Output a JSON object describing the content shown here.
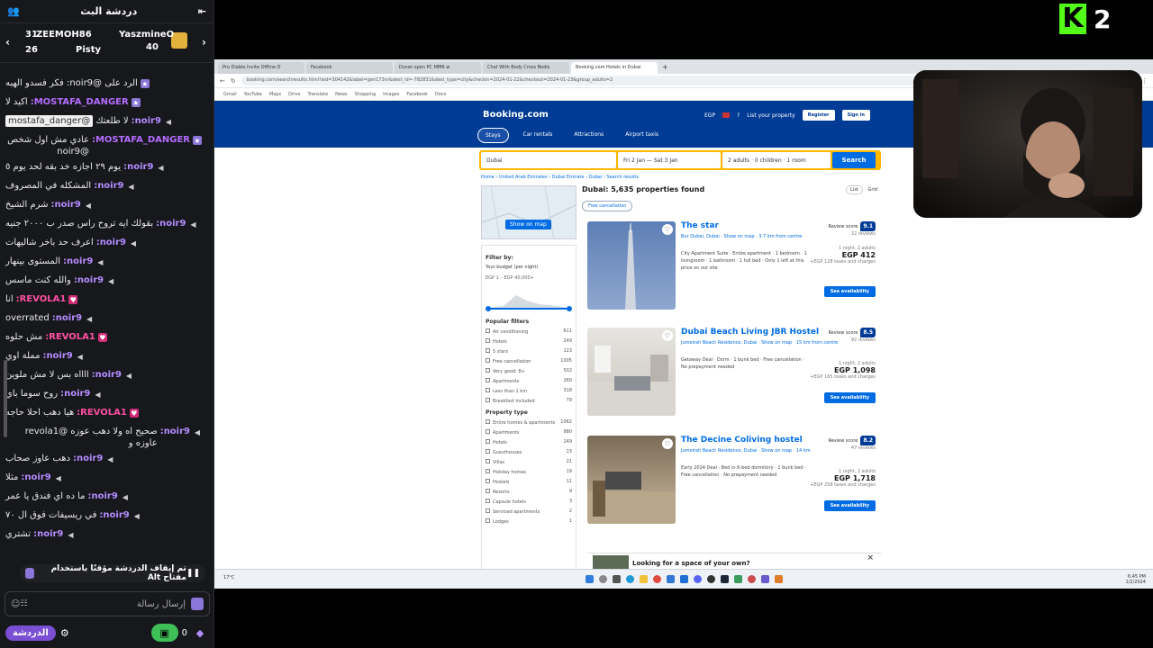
{
  "chat": {
    "title": "دردشة البث",
    "leaders": [
      {
        "name": "YaszmineO",
        "count": "40"
      },
      {
        "name": "ZEEMOH86",
        "count": "31"
      },
      {
        "name": "Pisty",
        "count": "26"
      }
    ],
    "messages": [
      {
        "user": "",
        "text": "الرد على @noir9: فكر فسدو الهبه",
        "icon": "mod",
        "ucls": "u-noir"
      },
      {
        "user": "MOSTAFA_DANGER:",
        "text": "اكيد لا",
        "icon": "mod",
        "ucls": "u-mos"
      },
      {
        "user": "noir9:",
        "text": "لا طلعتك",
        "mention": "@mostafa_danger",
        "icon": "vol",
        "ucls": "u-noir"
      },
      {
        "user": "MOSTAFA_DANGER:",
        "text": "عادي مش اول شخص @noir9",
        "icon": "mod",
        "ucls": "u-mos"
      },
      {
        "user": "noir9:",
        "text": "يوم ٢٩ اجازه خد بقه لحد يوم ٥",
        "icon": "vol",
        "ucls": "u-noir"
      },
      {
        "user": "noir9:",
        "text": "المشكله في المصروف",
        "icon": "vol",
        "ucls": "u-noir"
      },
      {
        "user": "noir9:",
        "text": "شرم الشيخ",
        "icon": "vol",
        "ucls": "u-noir"
      },
      {
        "user": "noir9:",
        "text": "بقولك ايه تروح راس صدر ب ٢٠٠٠ جنيه",
        "icon": "vol",
        "ucls": "u-noir"
      },
      {
        "user": "noir9:",
        "text": "اعرف حد باخر شاليهات",
        "icon": "vol",
        "ucls": "u-noir"
      },
      {
        "user": "noir9:",
        "text": "المستوى بينهار",
        "icon": "vol",
        "ucls": "u-noir"
      },
      {
        "user": "noir9:",
        "text": "والله كنت ماسس",
        "icon": "vol",
        "ucls": "u-noir"
      },
      {
        "user": "REVOLA1:",
        "text": "انا",
        "icon": "heart",
        "ucls": "u-rev"
      },
      {
        "user": "noir9:",
        "text": "overrated",
        "icon": "vol",
        "ucls": "u-noir"
      },
      {
        "user": "REVOLA1:",
        "text": "مش حلوه",
        "icon": "heart",
        "ucls": "u-rev"
      },
      {
        "user": "noir9:",
        "text": "مملة اوي",
        "icon": "vol",
        "ucls": "u-noir"
      },
      {
        "user": "noir9:",
        "text": "ااااه بس لا مش ملوين",
        "icon": "vol",
        "ucls": "u-noir"
      },
      {
        "user": "noir9:",
        "text": "روح سوما باي",
        "icon": "vol",
        "ucls": "u-noir"
      },
      {
        "user": "REVOLA1:",
        "text": "هيا دهب احلا حاجه",
        "icon": "heart",
        "ucls": "u-rev"
      },
      {
        "user": "noir9:",
        "text": "صحيح اه ولا دهب عوزه @revola1 عاوزه و",
        "icon": "vol",
        "ucls": "u-noir"
      },
      {
        "user": "noir9:",
        "text": "دهب عاوز صحاب",
        "icon": "vol",
        "ucls": "u-noir"
      },
      {
        "user": "noir9:",
        "text": "مثلا",
        "icon": "vol",
        "ucls": "u-noir"
      },
      {
        "user": "noir9:",
        "text": "ما ده اي فندق يا عمر",
        "icon": "vol",
        "ucls": "u-noir"
      },
      {
        "user": "noir9:",
        "text": "في ريسيفات فوق ال ٧٠",
        "icon": "vol",
        "ucls": "u-noir"
      },
      {
        "user": "noir9:",
        "text": "تشتري",
        "icon": "vol",
        "ucls": "u-noir"
      }
    ],
    "pinned": "تم إيقاف الدردشة مؤقتًا باستخدام مفتاح Alt",
    "input_placeholder": "إرسال رسالة",
    "send_label": "الدردشة",
    "points": "0"
  },
  "browser": {
    "tabs": [
      "Pro Diablo Invite Offline D",
      "Facebook",
      "Duran spen PC MMR w",
      "Chat With Body Cross Bodis",
      "Booking.com Hotels in Dubai",
      "+"
    ],
    "active_tab": 4,
    "url": "booking.com/searchresults.html?aid=304142&label=gen173nr&dest_id=-782831&dest_type=city&checkin=2024-01-22&checkout=2024-01-23&group_adults=2",
    "bookmarks": [
      "Gmail",
      "YouTube",
      "Maps",
      "Drive",
      "Translate",
      "News",
      "Shopping",
      "Images",
      "Facebook",
      "Docs"
    ],
    "status_url": "https://www.booking.com/hotel/ae/the-star-dubai.html?aid=304142&label=gen173nr"
  },
  "booking": {
    "logo": "Booking.com",
    "currency": "EGP",
    "list_property": "List your property",
    "register": "Register",
    "sign_in": "Sign in",
    "nav": [
      "Stays",
      "Car rentals",
      "Attractions",
      "Airport taxis"
    ],
    "search": {
      "dest": "Dubai",
      "dates": "Fri 2 Jan — Sat 3 Jan",
      "guests": "2 adults · 0 children · 1 room",
      "button": "Search"
    },
    "crumbs": "Home › United Arab Emirates › Dubai Emirate › Dubai › Search results",
    "show_map": "Show on map",
    "filter_title": "Filter by:",
    "budget_title": "Your budget (per night)",
    "budget_range": "EGP 1 – EGP 40,000+",
    "popular_title": "Popular filters",
    "popular": [
      {
        "label": "Air conditioning",
        "count": "611"
      },
      {
        "label": "Hotels",
        "count": "249"
      },
      {
        "label": "5 stars",
        "count": "123"
      },
      {
        "label": "Free cancellation",
        "count": "1005"
      },
      {
        "label": "Very good: 8+",
        "count": "502"
      },
      {
        "label": "Apartments",
        "count": "260"
      },
      {
        "label": "Less than 1 km",
        "count": "318"
      },
      {
        "label": "Breakfast included",
        "count": "79"
      }
    ],
    "ptype_title": "Property type",
    "ptypes": [
      {
        "label": "Entire homes & apartments",
        "count": "1062"
      },
      {
        "label": "Apartments",
        "count": "980"
      },
      {
        "label": "Hotels",
        "count": "249"
      },
      {
        "label": "Guesthouses",
        "count": "23"
      },
      {
        "label": "Villas",
        "count": "21"
      },
      {
        "label": "Holiday homes",
        "count": "19"
      },
      {
        "label": "Hostels",
        "count": "11"
      },
      {
        "label": "Resorts",
        "count": "9"
      },
      {
        "label": "Capsule hotels",
        "count": "3"
      },
      {
        "label": "Serviced apartments",
        "count": "2"
      },
      {
        "label": "Lodges",
        "count": "1"
      }
    ],
    "results_title": "Dubai: 5,635 properties found",
    "free_cancel_pill": "Free cancellation",
    "list_label": "List",
    "grid_label": "Grid",
    "cards": [
      {
        "title": "The star",
        "sub": "Bur Dubai, Dubai · Show on map · 3.7 km from centre",
        "desc": "City Apartment Suite · Entire apartment · 1 bedroom · 1 livingroom · 1 bathroom · 1 full bed · Only 1 left at this price on our site",
        "review": "Review score",
        "reviews": "32 reviews",
        "score": "9.1",
        "nights": "1 night, 2 adults",
        "price": "EGP 412",
        "taxes": "+EGP 128 taxes and charges",
        "avail": "See availability"
      },
      {
        "title": "Dubai Beach Living JBR Hostel",
        "sub": "Jumeirah Beach Residence, Dubai · Show on map · 15 km from centre",
        "desc": "Getaway Deal · Dorm · 1 bunk bed · Free cancellation · No prepayment needed",
        "review": "Review score",
        "reviews": "92 reviews",
        "score": "8.5",
        "nights": "1 night, 2 adults",
        "price": "EGP 1,098",
        "taxes": "+EGP 165 taxes and charges",
        "avail": "See availability"
      },
      {
        "title": "The Decine Coliving hostel",
        "sub": "Jumeirah Beach Residence, Dubai · Show on map · 14 km",
        "desc": "Early 2024 Deal · Bed in 6-bed dormitory · 1 bunk bed · Free cancellation · No prepayment needed",
        "review": "Review score",
        "reviews": "47 reviews",
        "score": "8.2",
        "nights": "1 night, 2 adults",
        "price": "EGP 1,718",
        "taxes": "+EGP 258 taxes and charges",
        "avail": "See availability"
      }
    ],
    "looking": "Looking for a space of your own?"
  },
  "taskbar": {
    "time": "6:45 PM",
    "date": "1/2/2024",
    "weather": "17°C"
  },
  "overlay": {
    "logo_k": "K",
    "logo_num": "2"
  },
  "colors": {
    "kick_green": "#53fc18",
    "booking_blue": "#003b95",
    "search_yellow": "#ffb700"
  }
}
